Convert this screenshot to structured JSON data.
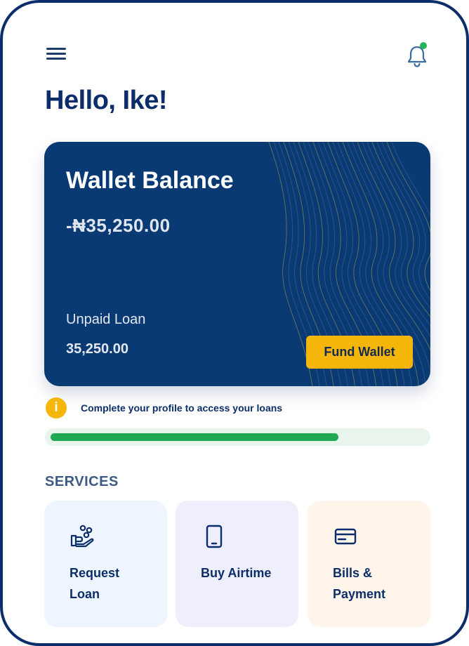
{
  "header": {
    "menu_icon": "hamburger-menu-icon",
    "notification_icon": "bell-icon",
    "notification_dot_color": "#23b45a",
    "greeting": "Hello, Ike!"
  },
  "wallet": {
    "title": "Wallet Balance",
    "balance": "-₦35,250.00",
    "loan_label": "Unpaid Loan",
    "loan_value": "35,250.00",
    "fund_button": "Fund Wallet",
    "card_color": "#0a3a74",
    "accent_color": "#f5b60c"
  },
  "profile_notice": {
    "icon": "info-icon",
    "icon_glyph": "i",
    "text": "Complete your profile to access  your loans",
    "progress_fraction": 0.77,
    "progress_color": "#1fa952"
  },
  "services": {
    "title": "SERVICES",
    "items": [
      {
        "label": "Request Loan",
        "icon": "hand-coins-icon",
        "bg": "#eef5ff"
      },
      {
        "label": "Buy Airtime",
        "icon": "phone-icon",
        "bg": "#efeefd"
      },
      {
        "label": "Bills & Payment",
        "icon": "credit-card-icon",
        "bg": "#fff5ea"
      }
    ]
  }
}
